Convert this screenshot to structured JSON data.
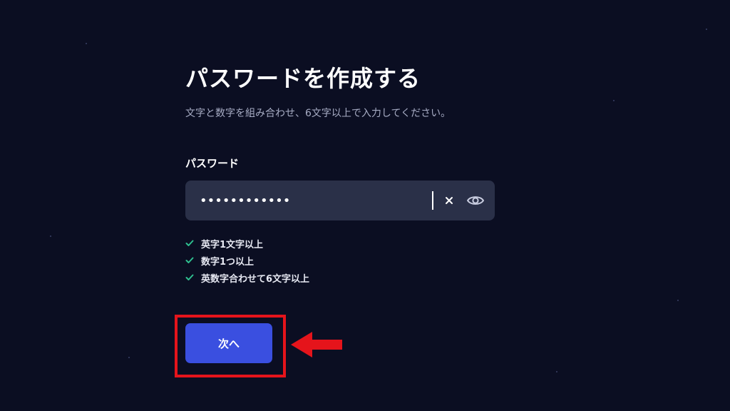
{
  "page": {
    "title": "パスワードを作成する",
    "subtitle": "文字と数字を組み合わせ、6文字以上で入力してください。"
  },
  "password_field": {
    "label": "パスワード",
    "value": "••••••••••••"
  },
  "rules": [
    {
      "label": "英字1文字以上",
      "met": true
    },
    {
      "label": "数字1つ以上",
      "met": true
    },
    {
      "label": "英数字合わせて6文字以上",
      "met": true
    }
  ],
  "next_button": {
    "label": "次へ"
  },
  "colors": {
    "background": "#0b0e22",
    "input_bg": "#2a3048",
    "button": "#3a4fe0",
    "check": "#2fbf8f",
    "annotation": "#e5141b"
  },
  "icons": {
    "clear": "close-icon",
    "toggle_visibility": "eye-icon",
    "rule_check": "check-icon",
    "annotation_arrow": "arrow-left-icon"
  }
}
